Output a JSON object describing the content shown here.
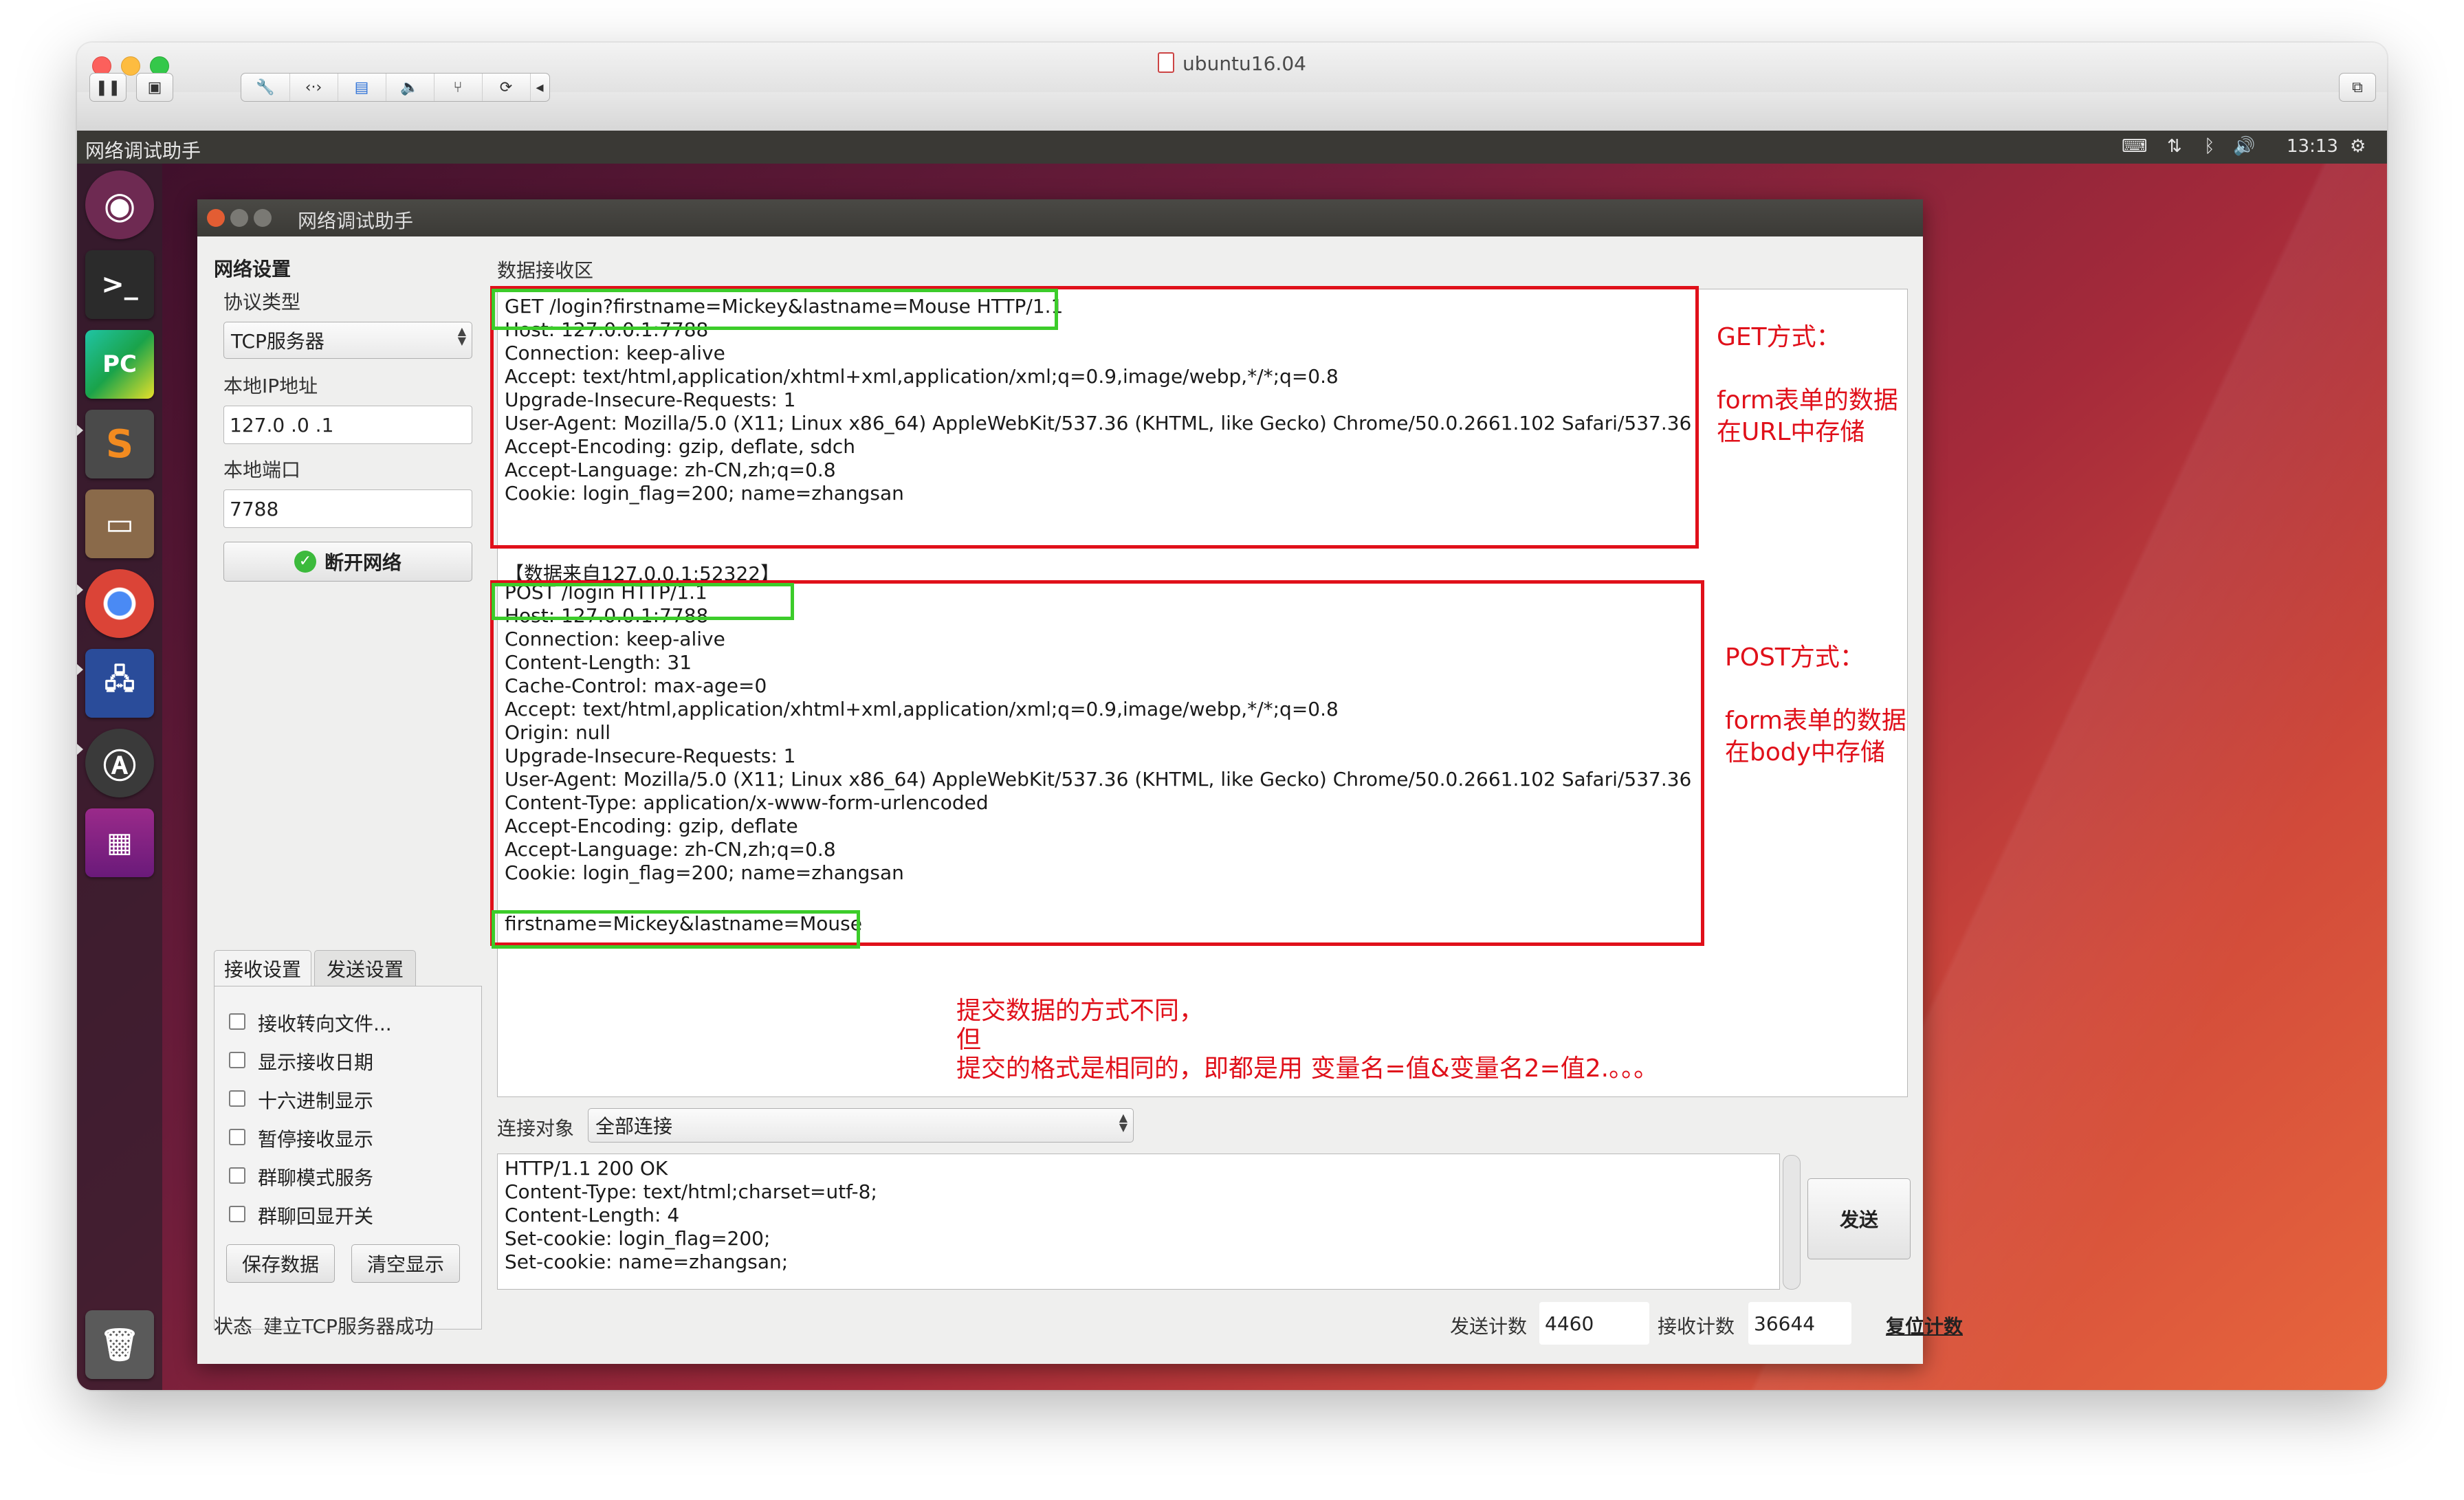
{
  "vm": {
    "title": "ubuntu16.04"
  },
  "topbar": {
    "app_name": "网络调试助手",
    "time": "13:13"
  },
  "window": {
    "title": "网络调试助手"
  },
  "settings": {
    "group_title": "网络设置",
    "protocol_label": "协议类型",
    "protocol_value": "TCP服务器",
    "ip_label": "本地IP地址",
    "ip_value": "127.0 .0 .1",
    "port_label": "本地端口",
    "port_value": "7788",
    "disconnect_label": "断开网络"
  },
  "receive_area": {
    "label": "数据接收区",
    "get_request": [
      "GET /login?firstname=Mickey&lastname=Mouse HTTP/1.1",
      "Host: 127.0.0.1:7788",
      "Connection: keep-alive",
      "Accept: text/html,application/xhtml+xml,application/xml;q=0.9,image/webp,*/*;q=0.8",
      "Upgrade-Insecure-Requests: 1",
      "User-Agent: Mozilla/5.0 (X11; Linux x86_64) AppleWebKit/537.36 (KHTML, like Gecko) Chrome/50.0.2661.102 Safari/537.36",
      "Accept-Encoding: gzip, deflate, sdch",
      "Accept-Language: zh-CN,zh;q=0.8",
      "Cookie: login_flag=200; name=zhangsan"
    ],
    "source_line": "【数据来自127.0.0.1:52322】",
    "post_request": [
      "POST /login HTTP/1.1",
      "Host: 127.0.0.1:7788",
      "Connection: keep-alive",
      "Content-Length: 31",
      "Cache-Control: max-age=0",
      "Accept: text/html,application/xhtml+xml,application/xml;q=0.9,image/webp,*/*;q=0.8",
      "Origin: null",
      "Upgrade-Insecure-Requests: 1",
      "User-Agent: Mozilla/5.0 (X11; Linux x86_64) AppleWebKit/537.36 (KHTML, like Gecko) Chrome/50.0.2661.102 Safari/537.36",
      "Content-Type: application/x-www-form-urlencoded",
      "Accept-Encoding: gzip, deflate",
      "Accept-Language: zh-CN,zh;q=0.8",
      "Cookie: login_flag=200; name=zhangsan"
    ],
    "post_body": "firstname=Mickey&lastname=Mouse"
  },
  "annotations": {
    "get_title": "GET方式：",
    "get_desc_1": "form表单的数据",
    "get_desc_2": "在URL中存储",
    "post_title": "POST方式：",
    "post_desc_1": "form表单的数据",
    "post_desc_2": "在body中存储",
    "summary_1": "提交数据的方式不同，",
    "summary_2": "但",
    "summary_3": "提交的格式是相同的，即都是用 变量名=值&变量名2=值2.。。。"
  },
  "tabs": {
    "receive": "接收设置",
    "send": "发送设置"
  },
  "receive_options": [
    "接收转向文件...",
    "显示接收日期",
    "十六进制显示",
    "暂停接收显示",
    "群聊模式服务",
    "群聊回显开关"
  ],
  "buttons": {
    "save_data": "保存数据",
    "clear_display": "清空显示",
    "send": "发送",
    "reset_count": "复位计数"
  },
  "connection": {
    "label": "连接对象",
    "value": "全部连接"
  },
  "send_area": {
    "lines": [
      "HTTP/1.1 200 OK",
      "Content-Type: text/html;charset=utf-8;",
      "Content-Length: 4",
      "Set-cookie: login_flag=200;",
      "Set-cookie: name=zhangsan;"
    ]
  },
  "status": {
    "label": "状态",
    "text": "建立TCP服务器成功",
    "send_count_label": "发送计数",
    "send_count": "4460",
    "recv_count_label": "接收计数",
    "recv_count": "36644"
  },
  "icons": {
    "launcher": [
      "ubuntu-dash-icon",
      "terminal-icon",
      "pycharm-icon",
      "sublime-icon",
      "files-icon",
      "chrome-icon",
      "network-icon",
      "software-updater-icon",
      "workspace-icon",
      "trash-icon"
    ],
    "topbar": [
      "keyboard-icon",
      "network-arrows-icon",
      "bluetooth-icon",
      "volume-icon",
      "settings-gear-icon"
    ]
  }
}
